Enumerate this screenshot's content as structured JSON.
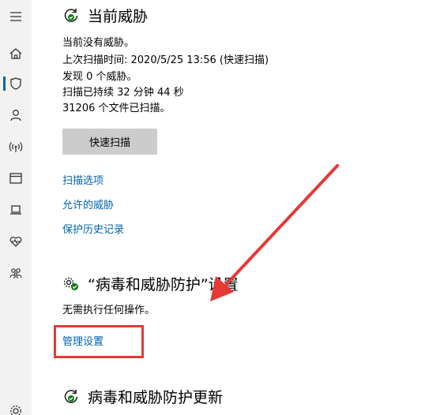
{
  "sidebar": {
    "items": [
      {
        "icon": "hamburger-menu-icon"
      },
      {
        "icon": "home-icon"
      },
      {
        "icon": "shield-icon",
        "active": true
      },
      {
        "icon": "person-icon"
      },
      {
        "icon": "wifi-antenna-icon"
      },
      {
        "icon": "app-browser-icon"
      },
      {
        "icon": "laptop-icon"
      },
      {
        "icon": "heart-pulse-icon"
      },
      {
        "icon": "family-icon"
      },
      {
        "icon": "gear-icon"
      }
    ]
  },
  "current_threats": {
    "title": "当前威胁",
    "icon": "refresh-check-icon",
    "lines": [
      "当前没有威胁。",
      "上次扫描时间: 2020/5/25 13:56 (快速扫描)",
      "发现 0 个威胁。",
      "扫描已持续 32 分钟 44 秒",
      "31206 个文件已扫描。"
    ],
    "scan_button": "快速扫描",
    "links": [
      "扫描选项",
      "允许的威胁",
      "保护历史记录"
    ]
  },
  "protection_settings": {
    "title": "“病毒和威胁防护”设置",
    "icon": "gear-check-icon",
    "status": "无需执行任何操作。",
    "manage_link": "管理设置"
  },
  "protection_updates": {
    "title": "病毒和威胁防护更新",
    "icon": "refresh-update-icon"
  },
  "colors": {
    "link": "#0063b1",
    "annotation_red": "#e53935",
    "sidebar_bg": "#f2f2f2"
  }
}
